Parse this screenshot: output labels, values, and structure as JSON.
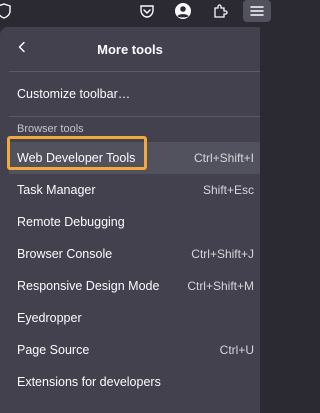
{
  "toolbar": {
    "icons": [
      "shield-icon",
      "pocket-icon",
      "account-icon",
      "extensions-icon",
      "menu-icon"
    ]
  },
  "panel": {
    "title": "More tools",
    "customize_label": "Customize toolbar…",
    "section_label": "Browser tools",
    "items": [
      {
        "label": "Web Developer Tools",
        "shortcut": "Ctrl+Shift+I"
      },
      {
        "label": "Task Manager",
        "shortcut": "Shift+Esc"
      },
      {
        "label": "Remote Debugging",
        "shortcut": ""
      },
      {
        "label": "Browser Console",
        "shortcut": "Ctrl+Shift+J"
      },
      {
        "label": "Responsive Design Mode",
        "shortcut": "Ctrl+Shift+M"
      },
      {
        "label": "Eyedropper",
        "shortcut": ""
      },
      {
        "label": "Page Source",
        "shortcut": "Ctrl+U"
      },
      {
        "label": "Extensions for developers",
        "shortcut": ""
      }
    ]
  },
  "colors": {
    "panel_bg": "#42414d",
    "toolbar_bg": "#2b2a33",
    "highlight": "#f2a93b",
    "hover_bg": "#52525e"
  }
}
